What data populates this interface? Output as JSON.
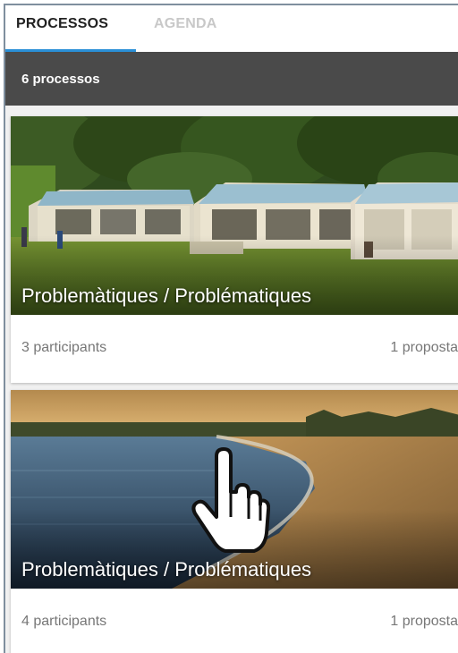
{
  "tabs": [
    {
      "label": "PROCESSOS",
      "active": true
    },
    {
      "label": "AGENDA",
      "active": false
    }
  ],
  "process_count": "6 processos",
  "cards": [
    {
      "title": "Problemàtiques / Problématiques",
      "participants": "3 participants",
      "proposals": "1 proposta",
      "image": "campsite-tents-photo"
    },
    {
      "title": "Problemàtiques / Problématiques",
      "participants": "4 participants",
      "proposals": "1 proposta",
      "image": "lake-beach-sunset-photo"
    }
  ],
  "colors": {
    "tab_underline": "#2a8fd6",
    "count_bar": "#4a4a4a"
  },
  "cursor_icon": "hand-pointer-icon"
}
